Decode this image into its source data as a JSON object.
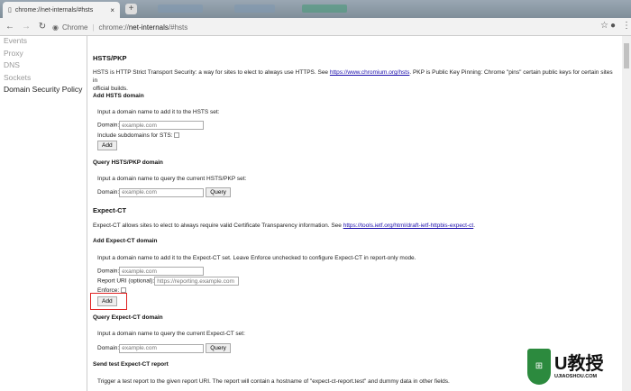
{
  "browser": {
    "tab_title": "chrome://net-internals/#hsts",
    "omnibox_label": "Chrome",
    "url_prefix": "chrome://",
    "url_host": "net-internals",
    "url_hash": "/#hsts"
  },
  "sidebar": {
    "items": [
      {
        "label": "Events"
      },
      {
        "label": "Proxy"
      },
      {
        "label": "DNS"
      },
      {
        "label": "Sockets"
      },
      {
        "label": "Domain Security Policy"
      }
    ]
  },
  "hsts": {
    "title": "HSTS/PKP",
    "desc_before": "HSTS is HTTP Strict Transport Security: a way for sites to elect to always use HTTPS. See ",
    "link": "https://www.chromium.org/hsts",
    "desc_after": ". PKP is Public Key Pinning: Chrome \"pins\" certain public keys for certain sites in",
    "desc_line2": "official builds.",
    "add": {
      "title": "Add HSTS domain",
      "instructions": "Input a domain name to add it to the HSTS set:",
      "domain_label": "Domain:",
      "domain_placeholder": "example.com",
      "subdomains_label": "Include subdomains for STS:",
      "add_button": "Add"
    },
    "query": {
      "title": "Query HSTS/PKP domain",
      "instructions": "Input a domain name to query the current HSTS/PKP set:",
      "domain_label": "Domain:",
      "domain_placeholder": "example.com",
      "query_button": "Query"
    }
  },
  "expect_ct": {
    "title": "Expect-CT",
    "desc": "Expect-CT allows sites to elect to always require valid Certificate Transparency information. See ",
    "link": "https://tools.ietf.org/html/draft-ietf-httpbis-expect-ct",
    "desc_end": ".",
    "add": {
      "title": "Add Expect-CT domain",
      "instructions": "Input a domain name to add it to the Expect-CT set. Leave Enforce unchecked to configure Expect-CT in report-only mode.",
      "domain_label": "Domain:",
      "domain_placeholder": "example.com",
      "report_label": "Report URI (optional):",
      "report_placeholder": "https://reporting.example.com",
      "enforce_label": "Enforce:",
      "add_button": "Add"
    },
    "query": {
      "title": "Query Expect-CT domain",
      "instructions": "Input a domain name to query the current Expect-CT set:",
      "domain_label": "Domain:",
      "domain_placeholder": "example.com",
      "query_button": "Query"
    },
    "test": {
      "title": "Send test Expect-CT report",
      "instructions": "Trigger a test report to the given report URI. The report will contain a hostname of \"expect-ct-report.test\" and dummy data in other fields."
    }
  },
  "watermark": {
    "brand": "U教授",
    "site": "UJIAOSHOU.COM"
  }
}
